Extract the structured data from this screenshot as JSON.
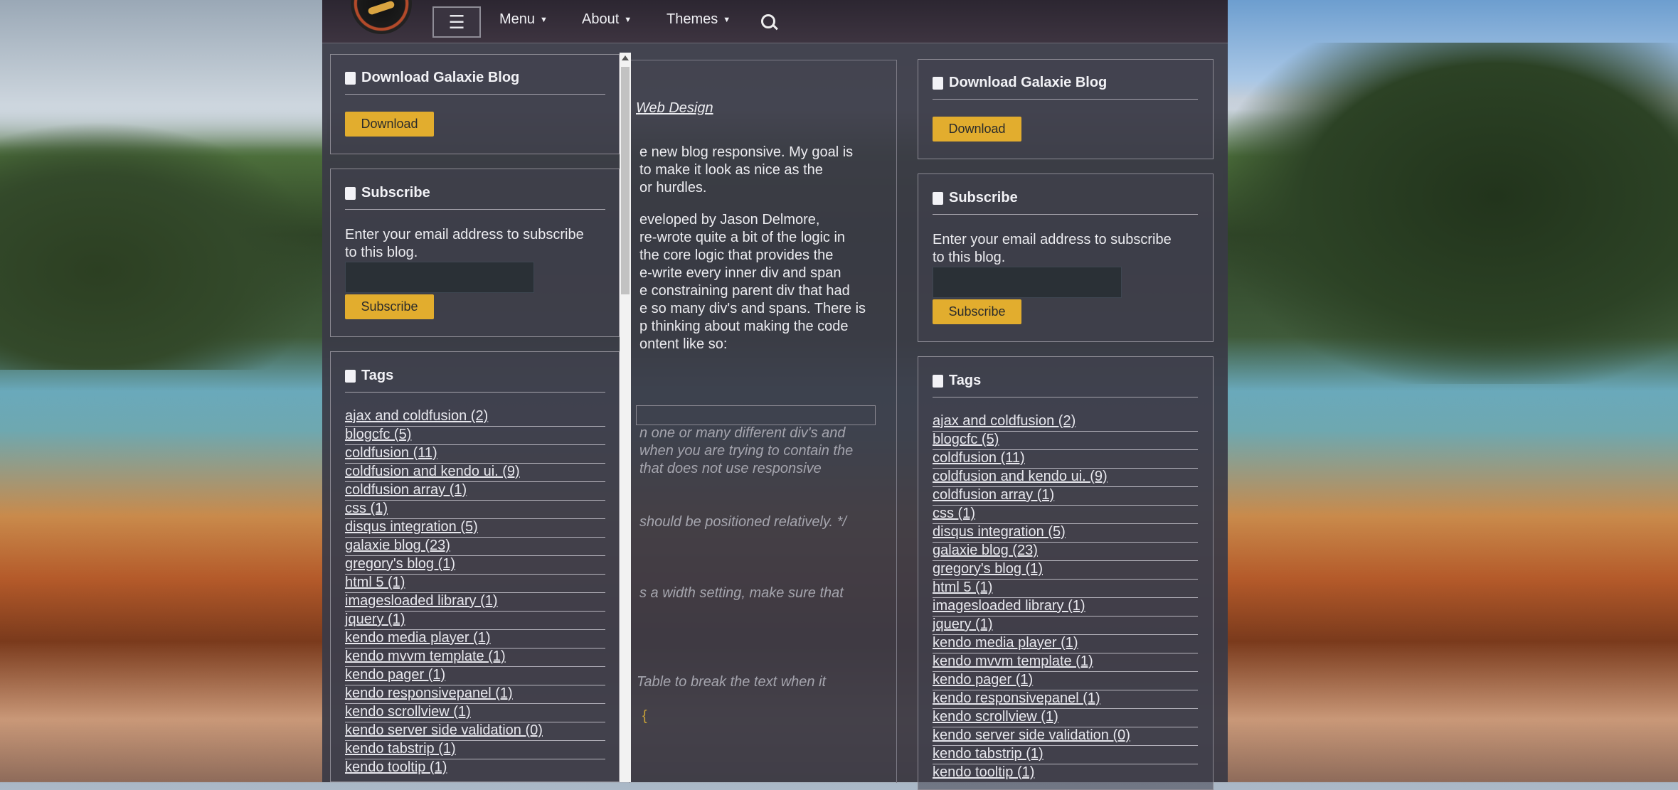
{
  "nav": {
    "menu_label": "Menu",
    "about_label": "About",
    "themes_label": "Themes"
  },
  "article": {
    "category_link": "Web Design",
    "paragraph1": [
      "e new blog responsive. My goal is",
      " to make it look as nice as the",
      "or hurdles."
    ],
    "paragraph2": [
      "eveloped by Jason Delmore,",
      " re-wrote quite a bit of the logic in",
      "the core logic that provides the",
      "e-write every inner div and span",
      "e constraining parent div that had",
      "e so many div's and spans. There is",
      "p thinking about making the code",
      "ontent like so:"
    ],
    "code_lines": [
      "n one or many different div's and",
      "when you are trying to contain the",
      " that does not use responsive",
      "should be positioned relatively. */",
      "s a width setting, make sure that",
      "Table to break the text when it"
    ],
    "code_brace": "{"
  },
  "download_widget": {
    "title": "Download Galaxie Blog",
    "button_label": "Download"
  },
  "subscribe_widget": {
    "title": "Subscribe",
    "text_line1": "Enter your email address to subscribe",
    "text_line2": "to this blog.",
    "button_label": "Subscribe"
  },
  "tags_widget": {
    "title": "Tags",
    "items": [
      "ajax and coldfusion (2)",
      "blogcfc (5)",
      "coldfusion (11)",
      "coldfusion and kendo ui. (9)",
      "coldfusion array (1)",
      "css (1)",
      "disqus integration (5)",
      "galaxie blog (23)",
      "gregory's blog (1)",
      "html 5 (1)",
      "imagesloaded library (1)",
      "jquery (1)",
      "kendo media player (1)",
      "kendo mvvm template (1)",
      "kendo pager (1)",
      "kendo responsivepanel (1)",
      "kendo scrollview (1)",
      "kendo server side validation (0)",
      "kendo tabstrip (1)",
      "kendo tooltip (1)"
    ]
  },
  "icons": {
    "hamburger": "menu-icon",
    "search": "search-icon",
    "download": "download-icon",
    "subscribe": "envelope-icon",
    "tags": "tags-icon"
  },
  "colors": {
    "accent_button": "#e2ad2e",
    "panel_bg": "#3a3a46",
    "text": "#ececf0"
  }
}
